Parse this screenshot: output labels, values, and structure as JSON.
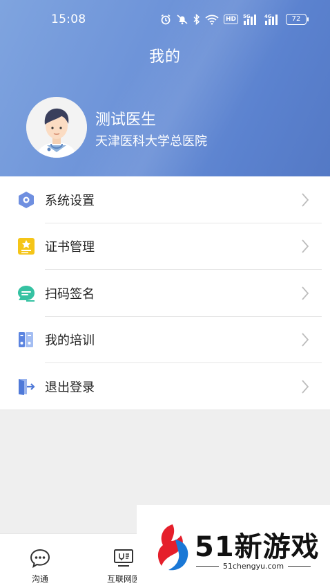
{
  "status_bar": {
    "time": "15:08",
    "network_5g": "5G",
    "network_4g": "4G",
    "hd_label": "HD",
    "battery": "72"
  },
  "header": {
    "title": "我的"
  },
  "profile": {
    "name": "测试医生",
    "hospital": "天津医科大学总医院"
  },
  "menu": {
    "items": [
      {
        "label": "系统设置",
        "icon": "settings-hexagon-icon",
        "color": "#6f8fe0"
      },
      {
        "label": "证书管理",
        "icon": "certificate-icon",
        "color": "#f5c518"
      },
      {
        "label": "扫码签名",
        "icon": "signature-icon",
        "color": "#35c2a2"
      },
      {
        "label": "我的培训",
        "icon": "training-binder-icon",
        "color": "#5b84e0"
      },
      {
        "label": "退出登录",
        "icon": "logout-door-icon",
        "color": "#4f79d8"
      }
    ]
  },
  "tabbar": {
    "tabs": [
      {
        "label": "沟通",
        "icon": "chat-bubble-icon"
      },
      {
        "label": "互联网医",
        "icon": "online-clinic-icon"
      }
    ]
  },
  "watermark": {
    "brand": "51新游戏",
    "url": "51chengyu.com"
  },
  "colors": {
    "header_start": "#7fa4df",
    "header_end": "#5479c5",
    "page_bg": "#efefef"
  }
}
